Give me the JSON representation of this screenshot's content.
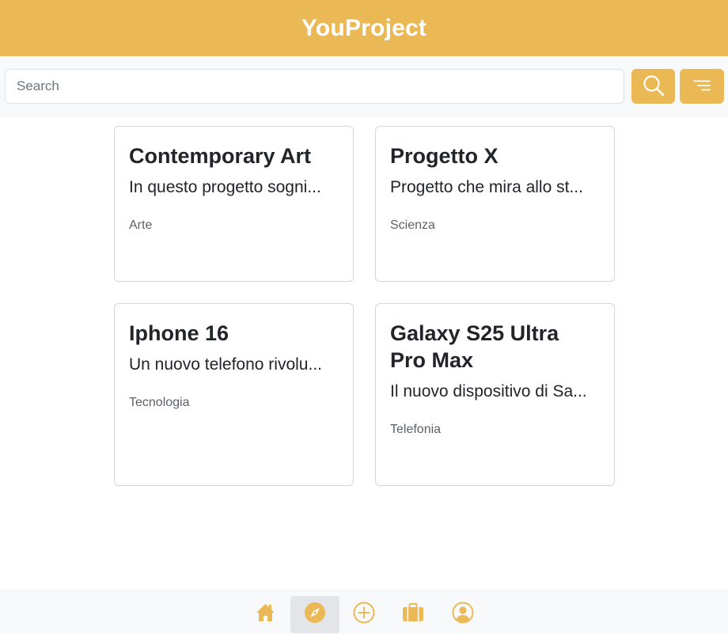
{
  "app": {
    "title": "YouProject"
  },
  "colors": {
    "accent": "#ebb856",
    "background": "#ffffff",
    "bar": "#f8f9fa"
  },
  "search": {
    "placeholder": "Search",
    "value": "",
    "search_icon": "search-icon",
    "filter_icon": "filter-icon"
  },
  "projects": [
    {
      "title": "Contemporary Art",
      "description": "In questo progetto sogni...",
      "category": "Arte"
    },
    {
      "title": "Progetto X",
      "description": "Progetto che mira allo st...",
      "category": "Scienza"
    },
    {
      "title": "Iphone 16",
      "description": "Un nuovo telefono rivolu...",
      "category": "Tecnologia"
    },
    {
      "title": "Galaxy S25 Ultra Pro Max",
      "description": "Il nuovo dispositivo di Sa...",
      "category": "Telefonia"
    }
  ],
  "nav": [
    {
      "icon": "home-icon",
      "active": false
    },
    {
      "icon": "compass-icon",
      "active": true
    },
    {
      "icon": "add-circle-icon",
      "active": false
    },
    {
      "icon": "briefcase-icon",
      "active": false
    },
    {
      "icon": "user-circle-icon",
      "active": false
    }
  ]
}
